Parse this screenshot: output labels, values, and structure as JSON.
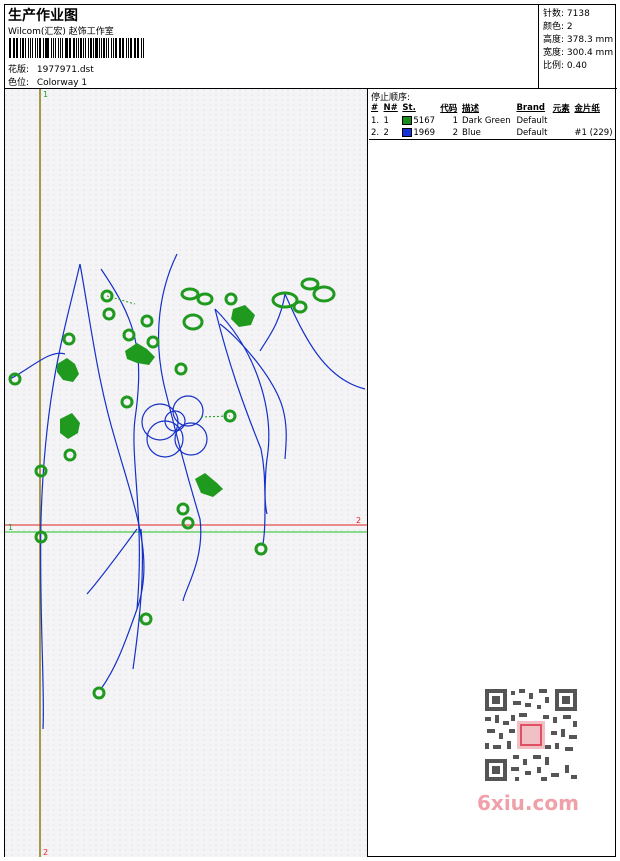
{
  "header": {
    "title": "生产作业图",
    "company": "Wilcom(汇宏) 赵饰工作室",
    "pattern_label": "花版:",
    "pattern_value": "1977971.dst",
    "colorway_label": "色位:",
    "colorway_value": "Colorway 1"
  },
  "stats": [
    {
      "label": "针数:",
      "value": "7138"
    },
    {
      "label": "颜色:",
      "value": "2"
    },
    {
      "label": "高度:",
      "value": "378.3 mm"
    },
    {
      "label": "宽度:",
      "value": "300.4 mm"
    },
    {
      "label": "比例:",
      "value": "0.40"
    }
  ],
  "stops": {
    "title": "停止顺序:",
    "columns": [
      "#",
      "N#",
      "St.",
      "代码",
      "描述",
      "Brand",
      "元素",
      "金片纸"
    ],
    "rows": [
      {
        "num": "1.",
        "n": "1",
        "st": "5167",
        "code": "1",
        "desc": "Dark Green",
        "brand": "Default",
        "element": "",
        "sequin": "",
        "color": "#1a8a1a"
      },
      {
        "num": "2.",
        "n": "2",
        "st": "1969",
        "code": "2",
        "desc": "Blue",
        "brand": "Default",
        "element": "",
        "sequin": "#1 (229)",
        "color": "#1530d8"
      }
    ]
  },
  "markers": {
    "top_v": "1",
    "bottom_v": "2",
    "left_h": "1",
    "right_h": "2"
  },
  "watermark": {
    "brand": "6xiu.com"
  },
  "colors": {
    "green": "#1f9a1f",
    "blue": "#1530c8",
    "guide_v": "#8a7a10",
    "guide_red": "#e02020",
    "guide_green": "#20c020"
  }
}
